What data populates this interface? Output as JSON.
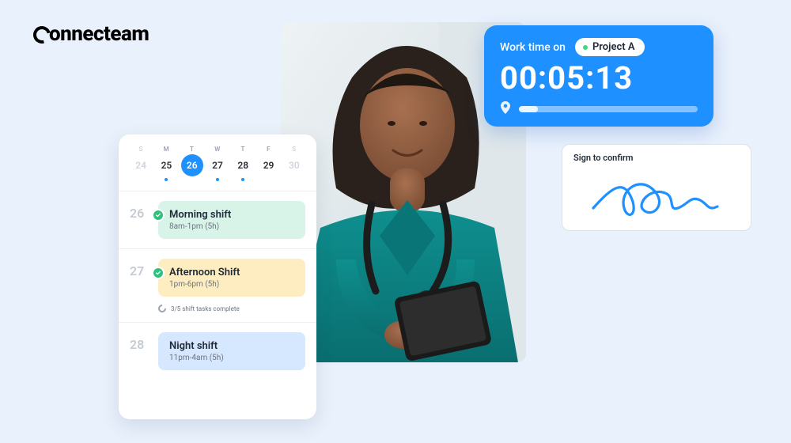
{
  "brand": {
    "name": "onnecteam"
  },
  "calendar": {
    "dow": [
      "S",
      "M",
      "T",
      "W",
      "T",
      "F",
      "S"
    ],
    "days": [
      {
        "n": "24",
        "fade": true,
        "dot": false
      },
      {
        "n": "25",
        "fade": false,
        "dot": true
      },
      {
        "n": "26",
        "fade": false,
        "dot": false,
        "selected": true
      },
      {
        "n": "27",
        "fade": false,
        "dot": true
      },
      {
        "n": "28",
        "fade": false,
        "dot": true
      },
      {
        "n": "29",
        "fade": false,
        "dot": false
      },
      {
        "n": "30",
        "fade": true,
        "dot": false
      }
    ],
    "shifts": [
      {
        "date": "26",
        "title": "Morning shift",
        "sub": "8am-1pm (5h)",
        "class": "card-mint",
        "badge": true
      },
      {
        "date": "27",
        "title": "Afternoon Shift",
        "sub": "1pm-6pm (5h)",
        "class": "card-amber",
        "badge": true,
        "tasks": "3/5 shift tasks complete"
      },
      {
        "date": "28",
        "title": "Night shift",
        "sub": "11pm-4am (5h)",
        "class": "card-blue",
        "badge": false
      }
    ]
  },
  "timer": {
    "label": "Work time on",
    "project": "Project A",
    "value": "00:05:13"
  },
  "signature": {
    "label": "Sign to confirm"
  },
  "colors": {
    "accent": "#1e90ff",
    "mint": "#d8f4e8",
    "amber": "#ffedc2",
    "lightblue": "#d6e8ff"
  }
}
